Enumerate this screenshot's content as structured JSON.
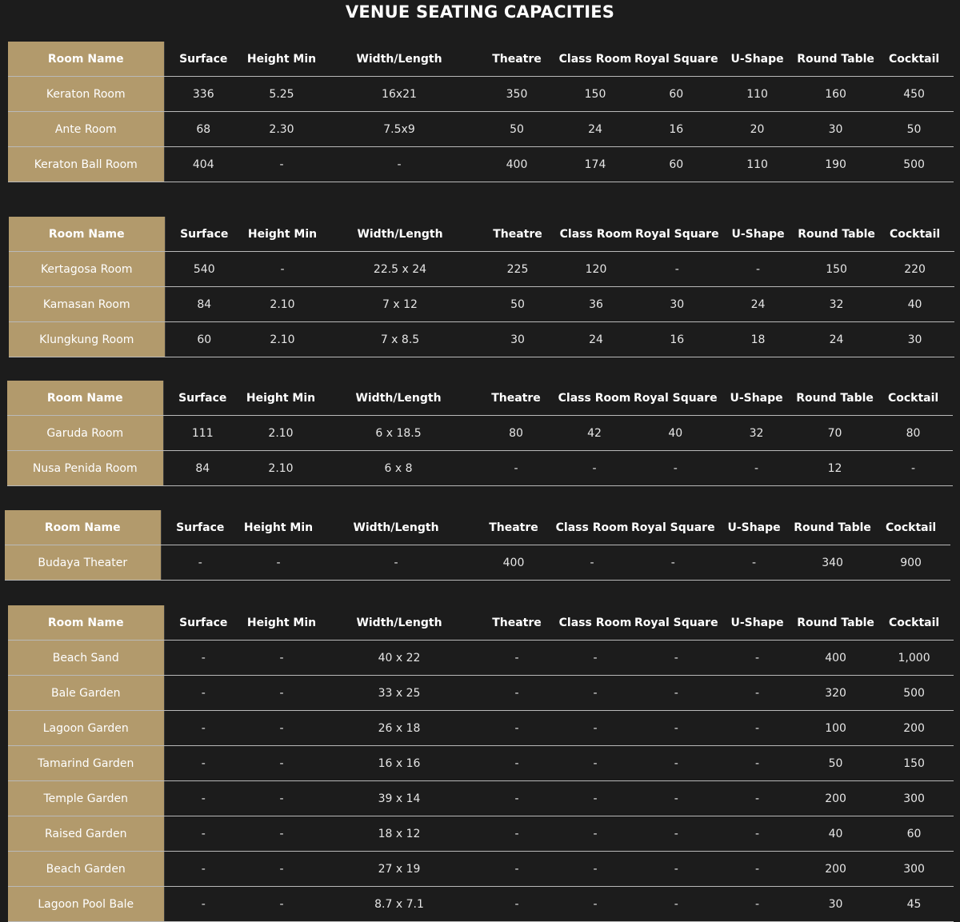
{
  "title": "VENUE SEATING CAPACITIES",
  "colors": {
    "background": "#1c1c1c",
    "accent_gold": "#b29a6c",
    "text": "#ffffff",
    "rule": "#b9b9b9"
  },
  "headers": [
    "Room Name",
    "Surface",
    "Height Min",
    "Width/Length",
    "Theatre",
    "Class Room",
    "Royal Square",
    "U-Shape",
    "Round Table",
    "Cocktail"
  ],
  "tables": [
    {
      "rows": [
        [
          "Keraton Room",
          "336",
          "5.25",
          "16x21",
          "350",
          "150",
          "60",
          "110",
          "160",
          "450"
        ],
        [
          "Ante Room",
          "68",
          "2.30",
          "7.5x9",
          "50",
          "24",
          "16",
          "20",
          "30",
          "50"
        ],
        [
          "Keraton Ball Room",
          "404",
          "-",
          "-",
          "400",
          "174",
          "60",
          "110",
          "190",
          "500"
        ]
      ]
    },
    {
      "rows": [
        [
          "Kertagosa Room",
          "540",
          "-",
          "22.5 x 24",
          "225",
          "120",
          "-",
          "-",
          "150",
          "220"
        ],
        [
          "Kamasan Room",
          "84",
          "2.10",
          "7 x 12",
          "50",
          "36",
          "30",
          "24",
          "32",
          "40"
        ],
        [
          "Klungkung Room",
          "60",
          "2.10",
          "7 x 8.5",
          "30",
          "24",
          "16",
          "18",
          "24",
          "30"
        ]
      ]
    },
    {
      "rows": [
        [
          "Garuda Room",
          "111",
          "2.10",
          "6 x 18.5",
          "80",
          "42",
          "40",
          "32",
          "70",
          "80"
        ],
        [
          "Nusa Penida Room",
          "84",
          "2.10",
          "6 x 8",
          "-",
          "-",
          "-",
          "-",
          "12",
          "-"
        ]
      ]
    },
    {
      "rows": [
        [
          "Budaya Theater",
          "-",
          "-",
          "-",
          "400",
          "-",
          "-",
          "-",
          "340",
          "900"
        ]
      ]
    },
    {
      "rows": [
        [
          "Beach Sand",
          "-",
          "-",
          "40 x 22",
          "-",
          "-",
          "-",
          "-",
          "400",
          "1,000"
        ],
        [
          "Bale Garden",
          "-",
          "-",
          "33 x 25",
          "-",
          "-",
          "-",
          "-",
          "320",
          "500"
        ],
        [
          "Lagoon Garden",
          "-",
          "-",
          "26 x 18",
          "-",
          "-",
          "-",
          "-",
          "100",
          "200"
        ],
        [
          "Tamarind Garden",
          "-",
          "-",
          "16 x 16",
          "-",
          "-",
          "-",
          "-",
          "50",
          "150"
        ],
        [
          "Temple Garden",
          "-",
          "-",
          "39 x 14",
          "-",
          "-",
          "-",
          "-",
          "200",
          "300"
        ],
        [
          "Raised Garden",
          "-",
          "-",
          "18 x 12",
          "-",
          "-",
          "-",
          "-",
          "40",
          "60"
        ],
        [
          "Beach Garden",
          "-",
          "-",
          "27 x 19",
          "-",
          "-",
          "-",
          "-",
          "200",
          "300"
        ],
        [
          "Lagoon Pool Bale",
          "-",
          "-",
          "8.7 x 7.1",
          "-",
          "-",
          "-",
          "-",
          "30",
          "45"
        ]
      ]
    }
  ]
}
